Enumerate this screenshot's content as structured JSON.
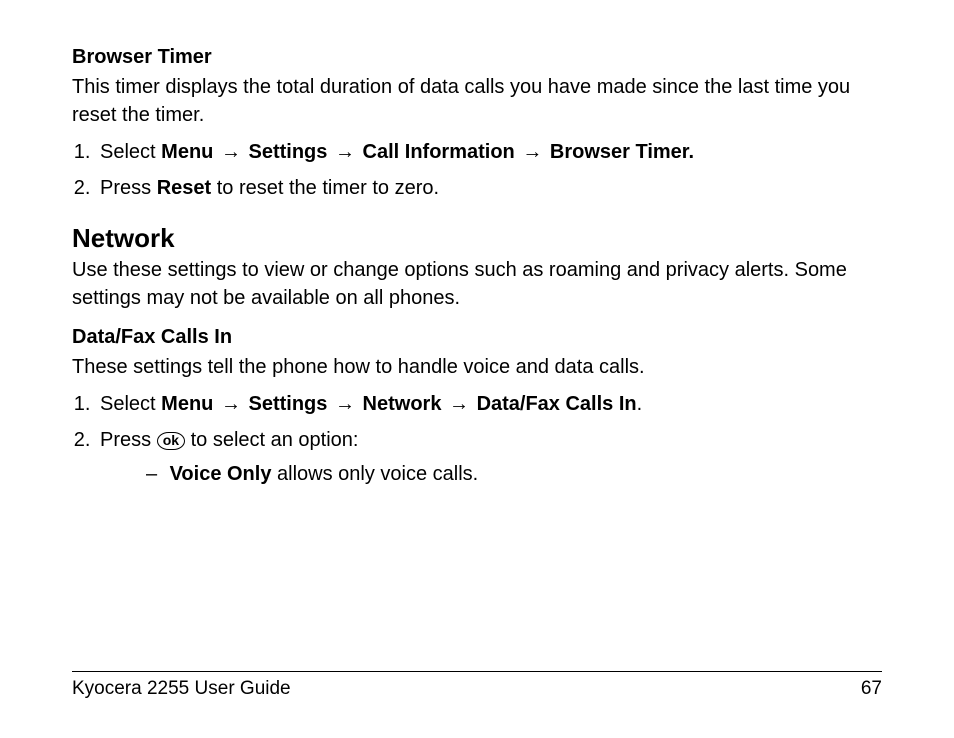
{
  "section1": {
    "heading": "Browser Timer",
    "intro": "This timer displays the total duration of data calls you have made since the last time you reset the timer.",
    "step1": {
      "prefix": "Select ",
      "m1": "Menu",
      "m2": "Settings",
      "m3": "Call Information",
      "m4": "Browser Timer."
    },
    "step2": {
      "prefix": "Press ",
      "bold": "Reset",
      "suffix": " to reset the timer to zero."
    }
  },
  "section2": {
    "heading": "Network",
    "intro": "Use these settings to view or change options such as roaming and privacy alerts. Some settings may not be available on all phones.",
    "sub_heading": "Data/Fax Calls In",
    "sub_intro": "These settings tell the phone how to handle voice and data calls.",
    "step1": {
      "prefix": "Select ",
      "m1": "Menu",
      "m2": "Settings",
      "m3": "Network",
      "m4": "Data/Fax Calls In",
      "period": "."
    },
    "step2": {
      "prefix": "Press ",
      "ok": "ok",
      "suffix": " to select an option:"
    },
    "option1": {
      "bold": "Voice Only",
      "suffix": " allows only voice calls."
    }
  },
  "arrow": "→",
  "footer": {
    "left": "Kyocera 2255 User Guide",
    "right": "67"
  }
}
